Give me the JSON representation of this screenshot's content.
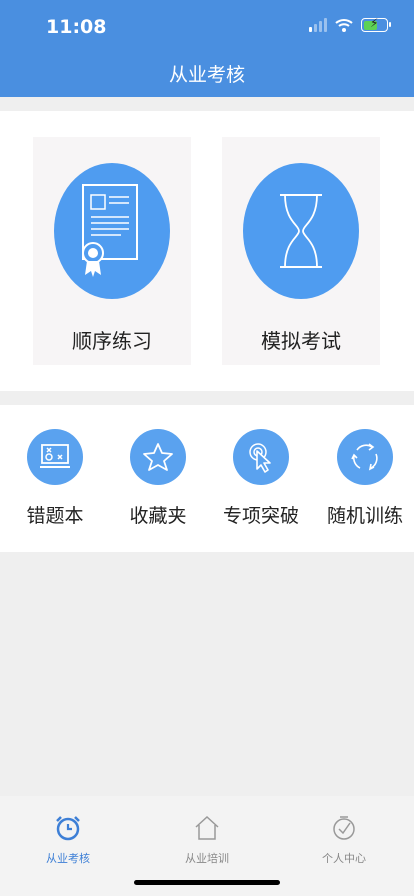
{
  "status": {
    "time": "11:08"
  },
  "header": {
    "title": "从业考核"
  },
  "main_cards": [
    {
      "label": "顺序练习",
      "icon": "certificate-icon"
    },
    {
      "label": "模拟考试",
      "icon": "hourglass-icon"
    }
  ],
  "quick_items": [
    {
      "label": "错题本",
      "icon": "mistake-board-icon"
    },
    {
      "label": "收藏夹",
      "icon": "star-icon"
    },
    {
      "label": "专项突破",
      "icon": "pointer-click-icon"
    },
    {
      "label": "随机训练",
      "icon": "refresh-icon"
    }
  ],
  "tabbar": {
    "items": [
      {
        "label": "从业考核",
        "icon": "alarm-clock-icon",
        "active": true
      },
      {
        "label": "从业培训",
        "icon": "house-icon",
        "active": false
      },
      {
        "label": "个人中心",
        "icon": "clock-check-icon",
        "active": false
      }
    ]
  },
  "colors": {
    "header": "#4a8fe0",
    "accent": "#3d7fd6",
    "icon_bg": "#4f9cf0"
  }
}
